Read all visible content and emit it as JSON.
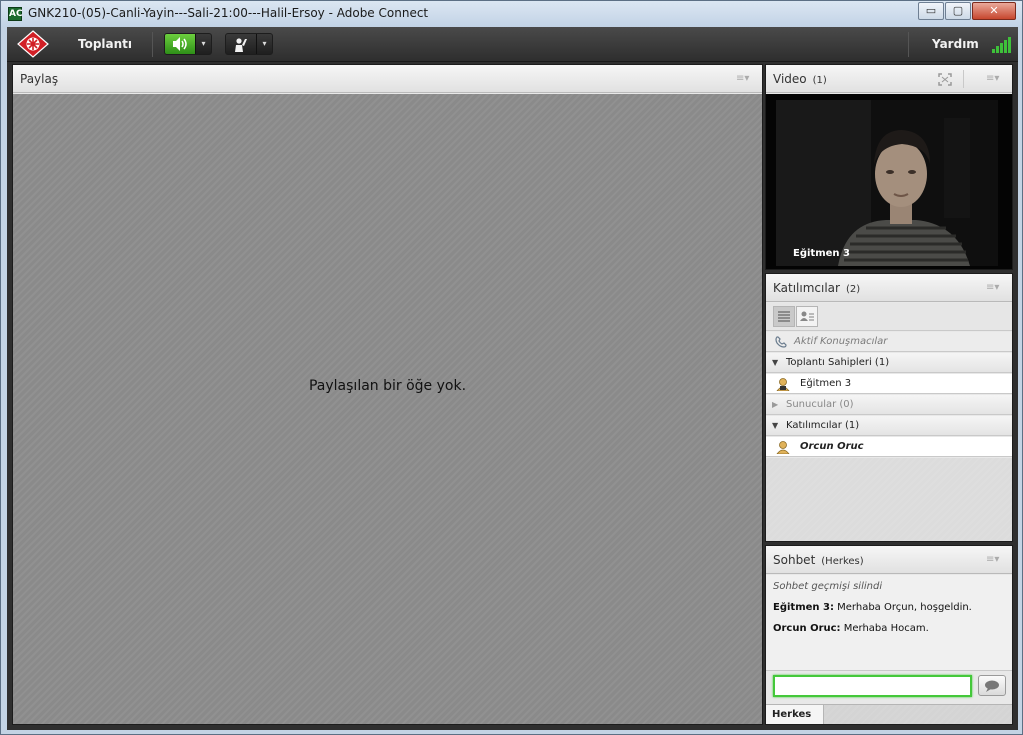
{
  "window": {
    "app_icon": "AC",
    "title": "GNK210-(05)-Canli-Yayin---Sali-21:00---Halil-Ersoy - Adobe Connect",
    "minimize": "▭",
    "maximize": "▢",
    "close": "✕"
  },
  "menubar": {
    "meeting_label": "Toplantı",
    "help_label": "Yardım",
    "speaker_icon": "speaker-icon",
    "raise_hand_icon": "raise-hand-icon",
    "dropdown_arrow": "▾"
  },
  "share_pod": {
    "title": "Paylaş",
    "menu_glyph": "≡▾",
    "empty_message": "Paylaşılan bir öğe yok."
  },
  "video_pod": {
    "title": "Video",
    "count": "(1)",
    "menu_glyph": "≡▾",
    "speaker_name": "Eğitmen 3"
  },
  "attendees_pod": {
    "title": "Katılımcılar",
    "count": "(2)",
    "menu_glyph": "≡▾",
    "active_speakers": "Aktif Konuşmacılar",
    "groups": [
      {
        "label": "Toplantı Sahipleri (1)",
        "expanded": true,
        "members": [
          "Eğitmen 3"
        ]
      },
      {
        "label": "Sunucular (0)",
        "expanded": false,
        "members": []
      },
      {
        "label": "Katılımcılar (1)",
        "expanded": true,
        "members": [
          "Orcun Oruc"
        ]
      }
    ],
    "expanded_glyph": "▼",
    "collapsed_glyph": "▶"
  },
  "chat_pod": {
    "title": "Sohbet",
    "scope": "(Herkes)",
    "menu_glyph": "≡▾",
    "system_message": "Sohbet geçmişi silindi",
    "messages": [
      {
        "sender": "Eğitmen 3:",
        "text": " Merhaba Orçun, hoşgeldin."
      },
      {
        "sender": "Orcun Oruc:",
        "text": " Merhaba Hocam."
      }
    ],
    "input_value": "",
    "tab_label": "Herkes"
  },
  "colors": {
    "accent_green": "#44c83a",
    "logo_red": "#d21f26",
    "signal_green": "#3ec13a"
  }
}
